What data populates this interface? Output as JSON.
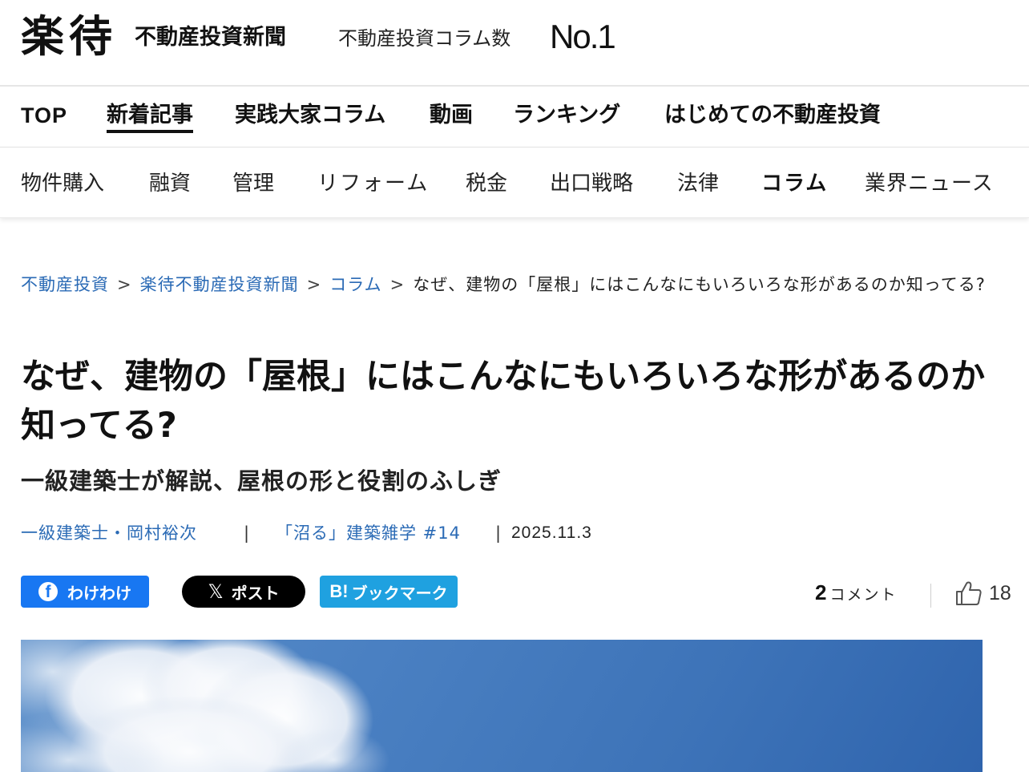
{
  "header": {
    "logo": "楽待",
    "logo_sub": "不動産投資新聞",
    "tagline": "不動産投資コラム数",
    "tagline_no1": "No.1"
  },
  "nav_primary": [
    {
      "label": "TOP"
    },
    {
      "label": "新着記事",
      "active": true
    },
    {
      "label": "実践大家コラム"
    },
    {
      "label": "動画"
    },
    {
      "label": "ランキング"
    },
    {
      "label": "はじめての不動産投資"
    }
  ],
  "nav_secondary": [
    {
      "label": "物件購入"
    },
    {
      "label": "融資"
    },
    {
      "label": "管理"
    },
    {
      "label": "リフォーム"
    },
    {
      "label": "税金"
    },
    {
      "label": "出口戦略"
    },
    {
      "label": "法律"
    },
    {
      "label": "コラム",
      "active": true
    },
    {
      "label": "業界ニュース"
    }
  ],
  "breadcrumb": {
    "items": [
      "不動産投資",
      "楽待不動産投資新聞",
      "コラム"
    ],
    "separator": ">",
    "current": "なぜ、建物の「屋根」にはこんなにもいろいろな形があるのか知ってる?"
  },
  "article": {
    "title": "なぜ、建物の「屋根」にはこんなにもいろいろな形があるのか知ってる?",
    "subtitle": "一級建築士が解説、屋根の形と役割のふしぎ",
    "author": "一級建築士・岡村裕次",
    "series": "「沼る」建築雑学 #14",
    "date": "2025.11.3",
    "meta_sep": "|"
  },
  "share": {
    "facebook_label": "わけわけ",
    "facebook_icon": "f",
    "x_label": "ポスト",
    "x_icon": "𝕏",
    "hatena_label": "ブックマーク",
    "hatena_icon": "B!",
    "colors": {
      "facebook": "#1877f2",
      "x": "#000000",
      "hatena": "#1fa1e0"
    }
  },
  "stats": {
    "comments_count": "2",
    "comments_label": "コメント",
    "likes_count": "18",
    "like_icon": "thumbs-up-icon"
  },
  "colors": {
    "link": "#2a6ab5",
    "text": "#111111"
  }
}
